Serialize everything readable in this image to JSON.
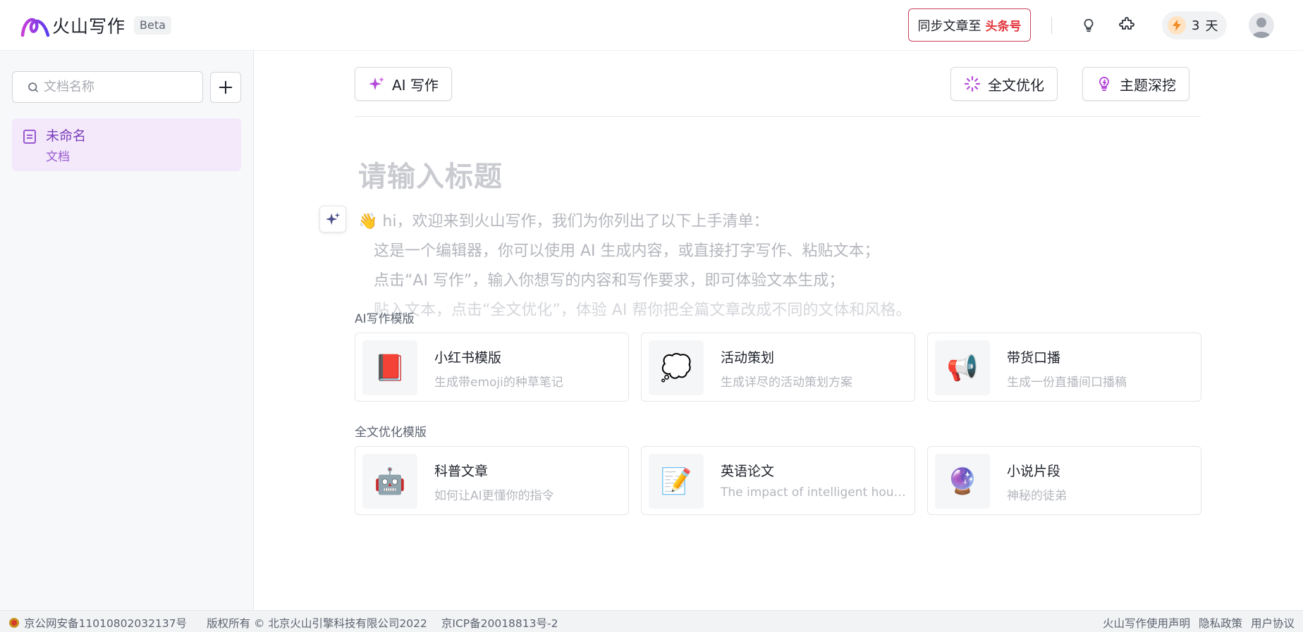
{
  "header": {
    "logo_text": "火山写作",
    "beta": "Beta",
    "sync_prefix": "同步文章至",
    "sync_brand": "头条号",
    "days_count": "3",
    "days_unit": "天",
    "colors": {
      "accent": "#7a3cb8",
      "brand_red": "#e2363d"
    }
  },
  "sidebar": {
    "search_placeholder": "文档名称",
    "documents": [
      {
        "title": "未命名",
        "subtitle": "文档"
      }
    ]
  },
  "toolbar": {
    "ai_write": "AI 写作",
    "full_optimize": "全文优化",
    "topic_dig": "主题深挖"
  },
  "editor": {
    "title_placeholder": "请输入标题",
    "intro": [
      "👋 hi，欢迎来到火山写作，我们为你列出了以下上手清单：",
      "这是一个编辑器，你可以使用 AI 生成内容，或直接打字写作、粘贴文本；",
      "点击“AI 写作”，输入你想写的内容和写作要求，即可体验文本生成；",
      "贴入文本，点击“全文优化”，体验 AI 帮你把全篇文章改成不同的文体和风格。"
    ]
  },
  "templates": {
    "ai_label": "AI写作模版",
    "ai_cards": [
      {
        "icon": "📕",
        "title": "小红书模版",
        "subtitle": "生成带emoji的种草笔记"
      },
      {
        "icon": "💭",
        "title": "活动策划",
        "subtitle": "生成详尽的活动策划方案"
      },
      {
        "icon": "📢",
        "title": "带货口播",
        "subtitle": "生成一份直播间口播稿"
      }
    ],
    "opt_label": "全文优化模版",
    "opt_cards": [
      {
        "icon": "🤖",
        "title": "科普文章",
        "subtitle": "如何让AI更懂你的指令"
      },
      {
        "icon": "📝",
        "title": "英语论文",
        "subtitle": "The impact of intelligent household products on life"
      },
      {
        "icon": "🔮",
        "title": "小说片段",
        "subtitle": "神秘的徒弟"
      }
    ]
  },
  "footer": {
    "police_record": "京公网安备11010802032137号",
    "copyright": "版权所有 © 北京火山引擎科技有限公司2022",
    "icp": "京ICP备20018813号-2",
    "links": [
      "火山写作使用声明",
      "隐私政策",
      "用户协议"
    ]
  }
}
